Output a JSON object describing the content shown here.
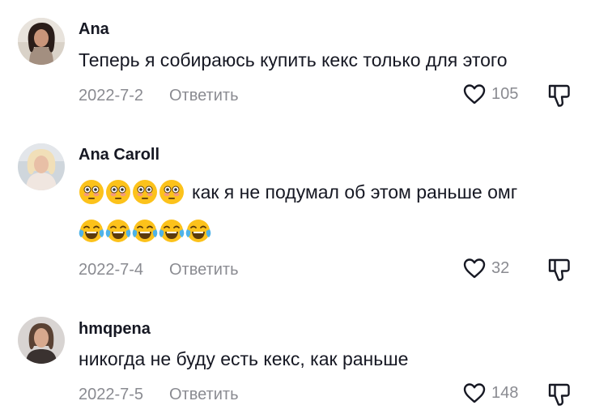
{
  "comments": [
    {
      "username": "Ana",
      "text": "Теперь я собираюсь купить кекс только для этого",
      "date": "2022-7-2",
      "reply_label": "Ответить",
      "likes": "105",
      "avatar_icon": "user-avatar-photo"
    },
    {
      "username": "Ana Caroll",
      "emoji_line_1": [
        "flushed-face",
        "flushed-face",
        "flushed-face",
        "flushed-face"
      ],
      "text": "как я не подумал об этом раньше омг",
      "emoji_line_2": [
        "tears-of-joy-face",
        "tears-of-joy-face",
        "tears-of-joy-face",
        "tears-of-joy-face",
        "tears-of-joy-face"
      ],
      "date": "2022-7-4",
      "reply_label": "Ответить",
      "likes": "32",
      "avatar_icon": "user-avatar-photo"
    },
    {
      "username": "hmqpena",
      "text": "никогда не буду есть кекс, как раньше",
      "date": "2022-7-5",
      "reply_label": "Ответить",
      "likes": "148",
      "avatar_icon": "user-avatar-photo"
    }
  ],
  "icons": {
    "like": "heart-outline-icon",
    "dislike": "thumbs-down-outline-icon"
  },
  "colors": {
    "text_primary": "#161823",
    "text_secondary": "#8a8b91",
    "emoji_yellow": "#fcc21b"
  }
}
